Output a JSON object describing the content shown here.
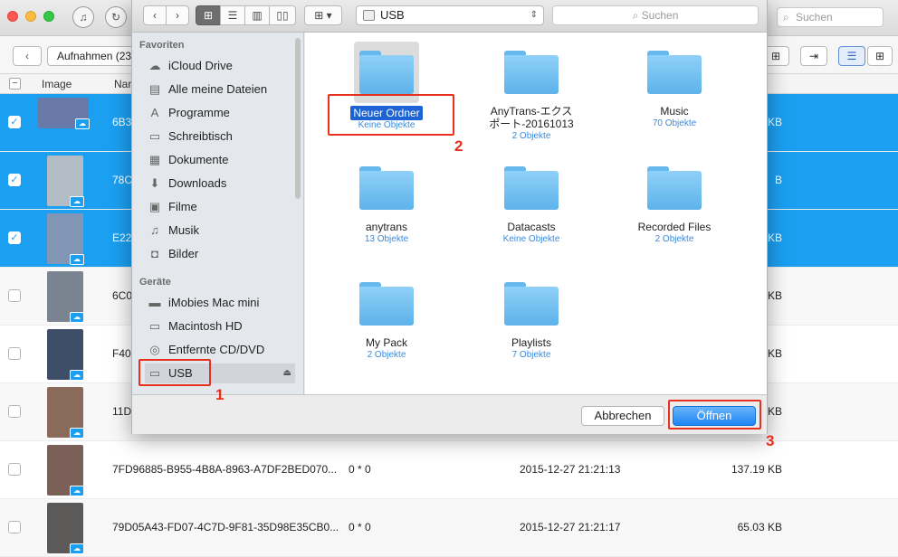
{
  "app": {
    "folder_button": "Aufnahmen (23)",
    "search_placeholder": "Suchen",
    "columns": {
      "image": "Image",
      "name": "Nar"
    },
    "rows": [
      {
        "name": "6B3",
        "info": "",
        "date": "",
        "size": "KB",
        "selected": true,
        "thumb": "#6a7aa8"
      },
      {
        "name": "78C",
        "info": "",
        "date": "",
        "size": "B",
        "selected": true,
        "thumb": "#b3bcc5"
      },
      {
        "name": "E22",
        "info": "",
        "date": "",
        "size": "KB",
        "selected": true,
        "thumb": "#8096b4"
      },
      {
        "name": "6C0",
        "info": "",
        "date": "",
        "size": "KB",
        "selected": false,
        "thumb": "#7a8390"
      },
      {
        "name": "F40",
        "info": "",
        "date": "",
        "size": "KB",
        "selected": false,
        "thumb": "#3e4e68"
      },
      {
        "name": "11D",
        "info": "",
        "date": "",
        "size": "KB",
        "selected": false,
        "thumb": "#8a6a5a"
      },
      {
        "name": "7FD96885-B955-4B8A-8963-A7DF2BED070...",
        "info": "0 * 0",
        "date": "2015-12-27 21:21:13",
        "size": "137.19 KB",
        "selected": false,
        "thumb": "#7a6058"
      },
      {
        "name": "79D05A43-FD07-4C7D-9F81-35D98E35CB0...",
        "info": "0 * 0",
        "date": "2015-12-27 21:21:17",
        "size": "65.03 KB",
        "selected": false,
        "thumb": "#5c5a58"
      }
    ]
  },
  "dialog": {
    "location": "USB",
    "search_placeholder": "Suchen",
    "sidebar": {
      "favorites_heading": "Favoriten",
      "favorites": [
        {
          "label": "iCloud Drive",
          "icon": "cloud-icon"
        },
        {
          "label": "Alle meine Dateien",
          "icon": "all-files-icon"
        },
        {
          "label": "Programme",
          "icon": "applications-icon"
        },
        {
          "label": "Schreibtisch",
          "icon": "desktop-icon"
        },
        {
          "label": "Dokumente",
          "icon": "documents-icon"
        },
        {
          "label": "Downloads",
          "icon": "downloads-icon"
        },
        {
          "label": "Filme",
          "icon": "movies-icon"
        },
        {
          "label": "Musik",
          "icon": "music-icon"
        },
        {
          "label": "Bilder",
          "icon": "pictures-icon"
        }
      ],
      "devices_heading": "Geräte",
      "devices": [
        {
          "label": "iMobies Mac mini",
          "icon": "computer-icon"
        },
        {
          "label": "Macintosh HD",
          "icon": "drive-icon"
        },
        {
          "label": "Entfernte CD/DVD",
          "icon": "disc-icon"
        },
        {
          "label": "USB",
          "icon": "usb-drive-icon"
        }
      ]
    },
    "folders": [
      {
        "name": "Neuer Ordner",
        "sub": "Keine Objekte"
      },
      {
        "name": "AnyTrans-エクス",
        "name2": "ポート-20161013",
        "sub": "2 Objekte"
      },
      {
        "name": "Music",
        "sub": "70 Objekte"
      },
      {
        "name": "anytrans",
        "sub": "13 Objekte"
      },
      {
        "name": "Datacasts",
        "sub": "Keine Objekte"
      },
      {
        "name": "Recorded Files",
        "sub": "2 Objekte"
      },
      {
        "name": "My Pack",
        "sub": "2 Objekte"
      },
      {
        "name": "Playlists",
        "sub": "7 Objekte"
      }
    ],
    "cancel_label": "Abbrechen",
    "open_label": "Öffnen"
  },
  "callouts": [
    "1",
    "2",
    "3"
  ],
  "colors": {
    "selection": "#1b9ff0",
    "accent": "#1d86f4",
    "callout": "#e8301e"
  }
}
